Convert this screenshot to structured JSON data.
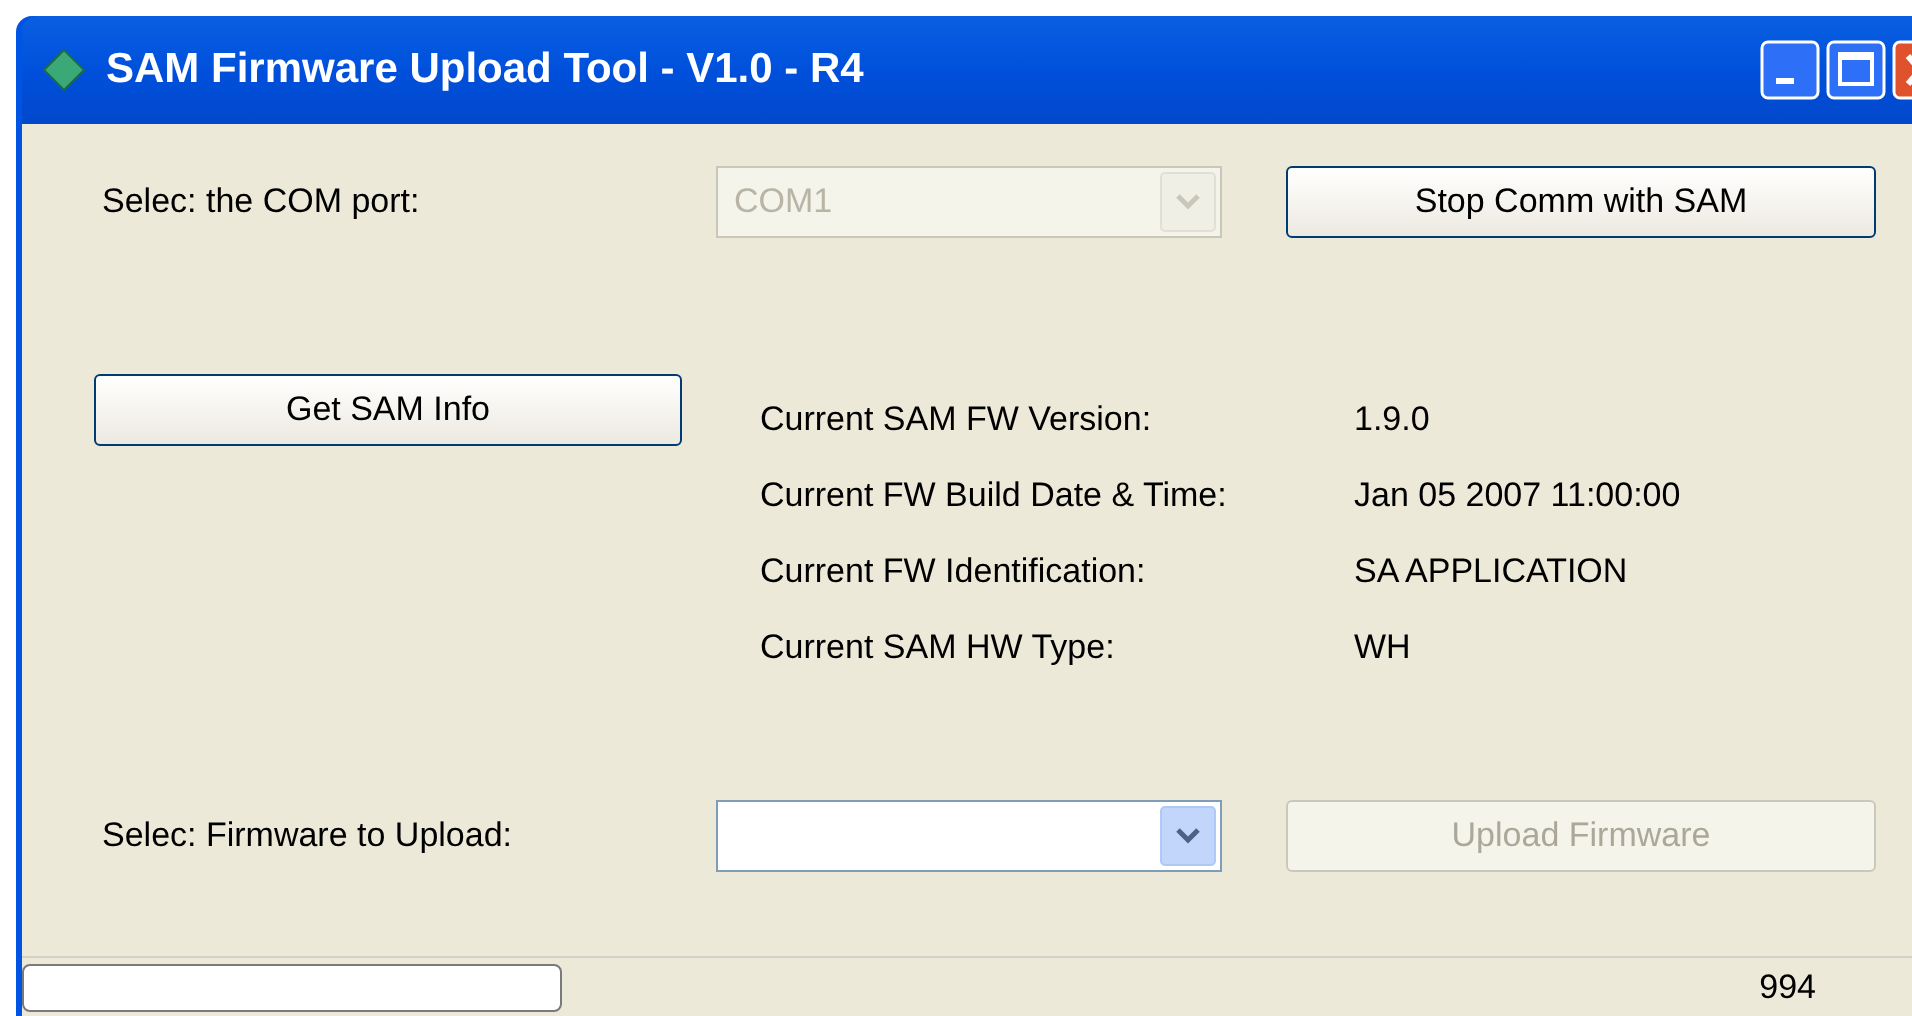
{
  "window": {
    "title": "SAM Firmware Upload Tool - V1.0 - R4"
  },
  "com_port": {
    "label": "Selec: the COM port:",
    "value": "COM1",
    "disabled": true
  },
  "stop_button": {
    "label": "Stop Comm with SAM",
    "disabled": false
  },
  "info_button": {
    "label": "Get SAM Info",
    "disabled": false
  },
  "info": [
    {
      "label": "Current SAM FW Version:",
      "value": "1.9.0"
    },
    {
      "label": "Current FW Build Date & Time:",
      "value": "Jan 05 2007 11:00:00"
    },
    {
      "label": "Current FW Identification:",
      "value": "SA APPLICATION"
    },
    {
      "label": "Current SAM HW Type:",
      "value": "WH"
    }
  ],
  "firmware": {
    "label": "Selec: Firmware to Upload:",
    "disabled": false
  },
  "upload_button": {
    "label": "Upload Firmware",
    "disabled": true
  },
  "status_bar": {
    "progress": {
      "level": 0
    },
    "count": "994"
  }
}
